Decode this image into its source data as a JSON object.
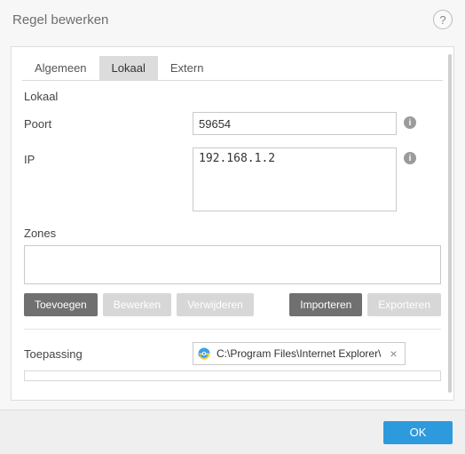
{
  "dialog": {
    "title": "Regel bewerken",
    "help_tooltip": "?"
  },
  "tabs": {
    "items": [
      {
        "label": "Algemeen",
        "active": false
      },
      {
        "label": "Lokaal",
        "active": true
      },
      {
        "label": "Extern",
        "active": false
      }
    ]
  },
  "section": {
    "heading": "Lokaal"
  },
  "fields": {
    "poort": {
      "label": "Poort",
      "value": "59654"
    },
    "ip": {
      "label": "IP",
      "value": "192.168.1.2"
    }
  },
  "zones": {
    "label": "Zones",
    "buttons": {
      "add": "Toevoegen",
      "edit": "Bewerken",
      "delete": "Verwijderen",
      "import": "Importeren",
      "export": "Exporteren"
    }
  },
  "application": {
    "label": "Toepassing",
    "path": "C:\\Program Files\\Internet Explorer\\",
    "icon": "internet-explorer-icon"
  },
  "footer": {
    "ok": "OK"
  }
}
